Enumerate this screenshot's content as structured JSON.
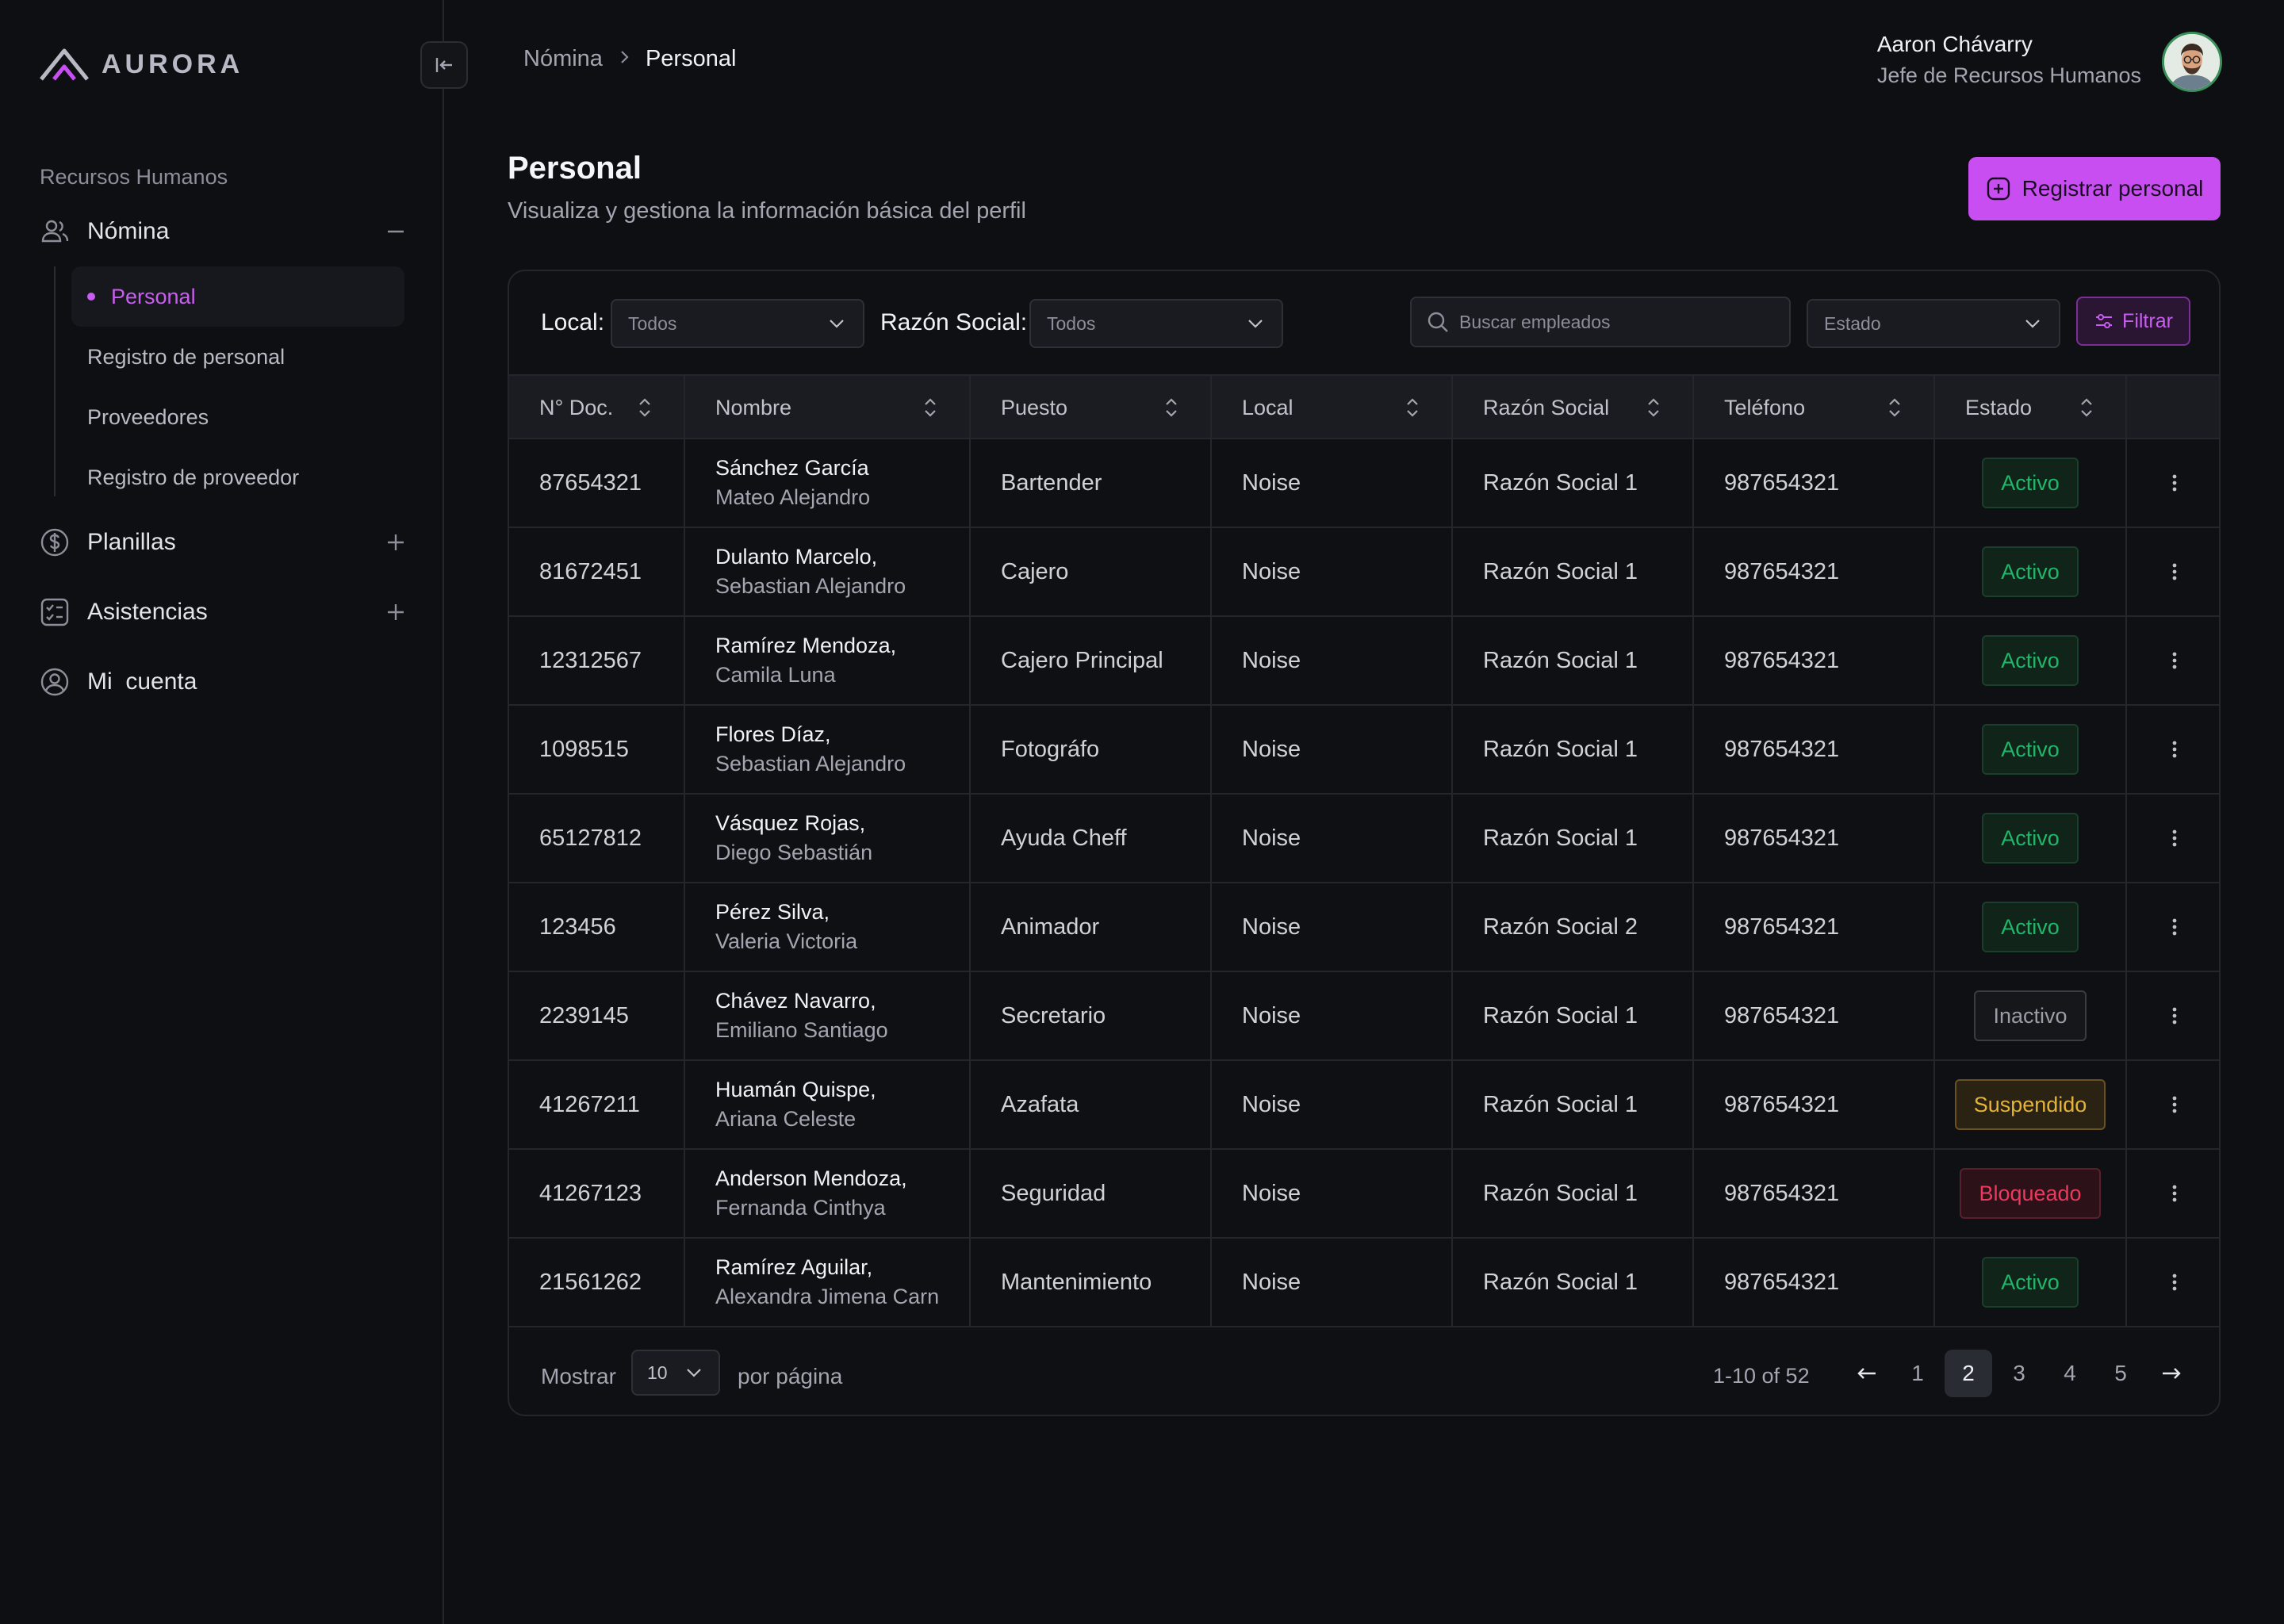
{
  "app": {
    "name": "AURORA"
  },
  "sidebar": {
    "section_label": "Recursos Humanos",
    "nomina": {
      "label": "Nómina",
      "icon": "users-icon",
      "children": [
        "Personal",
        "Registro de personal",
        "Proveedores",
        "Registro de proveedor"
      ],
      "active": "Personal"
    },
    "items": [
      {
        "label": "Planillas",
        "icon": "dollar-circle-icon"
      },
      {
        "label": "Asistencias",
        "icon": "checklist-icon"
      },
      {
        "label": "Mi  cuenta",
        "icon": "user-circle-icon"
      }
    ]
  },
  "breadcrumb": {
    "parent": "Nómina",
    "current": "Personal"
  },
  "user": {
    "name": "Aaron Chávarry",
    "role": "Jefe de Recursos Humanos"
  },
  "page": {
    "title": "Personal",
    "subtitle": "Visualiza y gestiona la información básica del perfil",
    "primary_button": "Registrar personal"
  },
  "filters": {
    "local_label": "Local:",
    "local_value": "Todos",
    "razon_label": "Razón Social:",
    "razon_value": "Todos",
    "search_placeholder": "Buscar empleados",
    "estado_value": "Estado",
    "filter_button": "Filtrar"
  },
  "table": {
    "columns": [
      "N° Doc.",
      "Nombre",
      "Puesto",
      "Local",
      "Razón Social",
      "Teléfono",
      "Estado"
    ],
    "rows": [
      {
        "doc": "87654321",
        "name1": "Sánchez García",
        "name2": "Mateo Alejandro",
        "puesto": "Bartender",
        "local": "Noise",
        "razon": "Razón Social 1",
        "tel": "987654321",
        "estado": "Activo",
        "tone": "green"
      },
      {
        "doc": "81672451",
        "name1": "Dulanto Marcelo,",
        "name2": "Sebastian Alejandro",
        "puesto": "Cajero",
        "local": "Noise",
        "razon": "Razón Social 1",
        "tel": "987654321",
        "estado": "Activo",
        "tone": "green"
      },
      {
        "doc": "12312567",
        "name1": "Ramírez Mendoza,",
        "name2": "Camila Luna",
        "puesto": "Cajero Principal",
        "local": "Noise",
        "razon": "Razón Social 1",
        "tel": "987654321",
        "estado": "Activo",
        "tone": "green"
      },
      {
        "doc": "1098515",
        "name1": "Flores Díaz,",
        "name2": "Sebastian Alejandro",
        "puesto": "Fotográfo",
        "local": "Noise",
        "razon": "Razón Social 1",
        "tel": "987654321",
        "estado": "Activo",
        "tone": "green"
      },
      {
        "doc": "65127812",
        "name1": "Vásquez Rojas,",
        "name2": "Diego Sebastián",
        "puesto": "Ayuda Cheff",
        "local": "Noise",
        "razon": "Razón Social 1",
        "tel": "987654321",
        "estado": "Activo",
        "tone": "green"
      },
      {
        "doc": "123456",
        "name1": "Pérez Silva,",
        "name2": "Valeria Victoria",
        "puesto": "Animador",
        "local": "Noise",
        "razon": "Razón Social 2",
        "tel": "987654321",
        "estado": "Activo",
        "tone": "green"
      },
      {
        "doc": "2239145",
        "name1": "Chávez Navarro,",
        "name2": "Emiliano Santiago",
        "puesto": "Secretario",
        "local": "Noise",
        "razon": "Razón Social 1",
        "tel": "987654321",
        "estado": "Inactivo",
        "tone": "gray"
      },
      {
        "doc": "41267211",
        "name1": "Huamán Quispe,",
        "name2": "Ariana Celeste",
        "puesto": "Azafata",
        "local": "Noise",
        "razon": "Razón Social 1",
        "tel": "987654321",
        "estado": "Suspendido",
        "tone": "yellow"
      },
      {
        "doc": "41267123",
        "name1": "Anderson Mendoza,",
        "name2": "Fernanda Cinthya",
        "puesto": "Seguridad",
        "local": "Noise",
        "razon": "Razón Social 1",
        "tel": "987654321",
        "estado": "Bloqueado",
        "tone": "red"
      },
      {
        "doc": "21561262",
        "name1": "Ramírez Aguilar,",
        "name2": "Alexandra Jimena Carn",
        "puesto": "Mantenimiento",
        "local": "Noise",
        "razon": "Razón Social 1",
        "tel": "987654321",
        "estado": "Activo",
        "tone": "green"
      }
    ]
  },
  "footer": {
    "show_label": "Mostrar",
    "page_size": "10",
    "per_page_label": "por página",
    "range": "1-10 of 52",
    "pages": [
      "1",
      "2",
      "3",
      "4",
      "5"
    ],
    "current_page": "2"
  },
  "colors": {
    "accent": "#c84ef2",
    "background": "#0e0f13",
    "status_active": "#1fb86a",
    "status_suspended": "#e6b33a",
    "status_blocked": "#ea3a5d"
  }
}
